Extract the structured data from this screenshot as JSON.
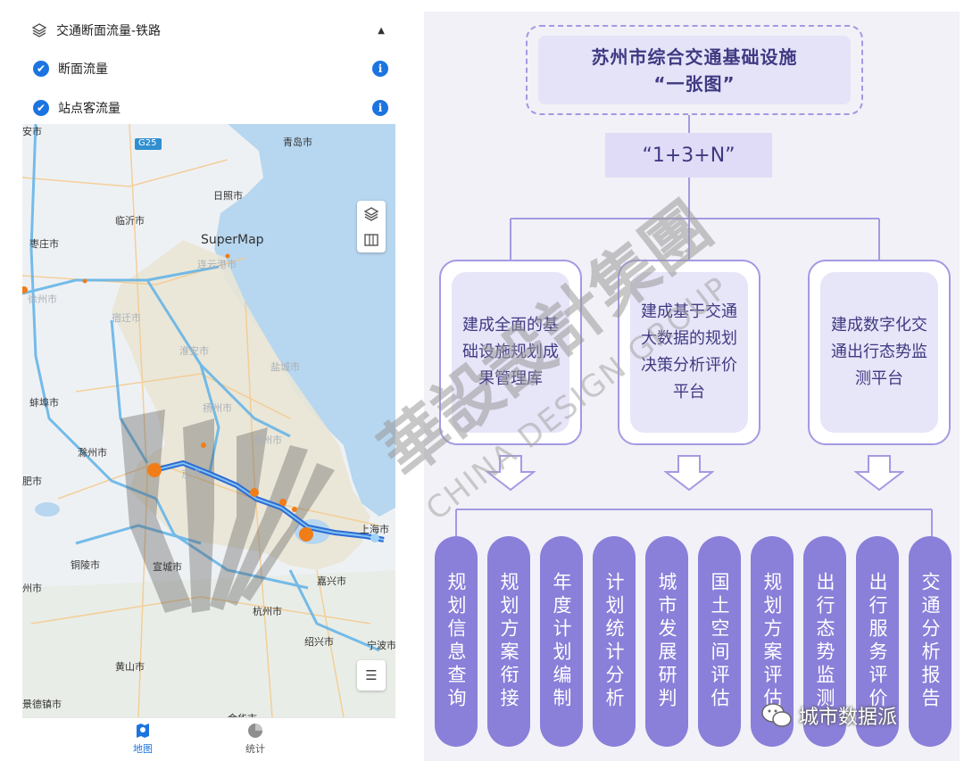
{
  "layer_panel": {
    "title": "交通断面流量-铁路",
    "options": [
      {
        "label": "断面流量",
        "checked": true
      },
      {
        "label": "站点客流量",
        "checked": true
      }
    ],
    "info_glyph": "i",
    "collapse_glyph": "▲"
  },
  "map": {
    "road_shield": "G25",
    "brand": "SuperMap",
    "cities": [
      {
        "name": "安市",
        "faint": false
      },
      {
        "name": "青岛市",
        "faint": false
      },
      {
        "name": "日照市",
        "faint": false
      },
      {
        "name": "临沂市",
        "faint": false
      },
      {
        "name": "枣庄市",
        "faint": false
      },
      {
        "name": "连云港市",
        "faint": true
      },
      {
        "name": "徐州市",
        "faint": true
      },
      {
        "name": "宿迁市",
        "faint": true
      },
      {
        "name": "淮安市",
        "faint": true
      },
      {
        "name": "盐城市",
        "faint": true
      },
      {
        "name": "蚌埠市",
        "faint": false
      },
      {
        "name": "扬州市",
        "faint": true
      },
      {
        "name": "泰州市",
        "faint": true
      },
      {
        "name": "滁州市",
        "faint": false
      },
      {
        "name": "肥市",
        "faint": false
      },
      {
        "name": "上海市",
        "faint": false
      },
      {
        "name": "铜陵市",
        "faint": false
      },
      {
        "name": "宣城市",
        "faint": false
      },
      {
        "name": "嘉兴市",
        "faint": false
      },
      {
        "name": "州市",
        "faint": false
      },
      {
        "name": "杭州市",
        "faint": false
      },
      {
        "name": "绍兴市",
        "faint": false
      },
      {
        "name": "宁波市",
        "faint": false
      },
      {
        "name": "黄山市",
        "faint": false
      },
      {
        "name": "景德镇市",
        "faint": false
      },
      {
        "name": "金华市",
        "faint": false
      },
      {
        "name": "京市",
        "faint": true
      }
    ],
    "icons": {
      "layers": "layers-icon",
      "basemap": "map-icon",
      "legend": "list-icon"
    }
  },
  "bottom_nav": {
    "items": [
      {
        "label": "地图",
        "icon": "map-pin-icon",
        "active": true
      },
      {
        "label": "统计",
        "icon": "pie-chart-icon",
        "active": false
      }
    ]
  },
  "diagram": {
    "title_line1": "苏州市综合交通基础设施",
    "title_line2": "“一张图”",
    "formula": "“1+3+N”",
    "goals": [
      "建成全面的基础设施规划成果管理库",
      "建成基于交通大数据的规划决策分析评价平台",
      "建成数字化交通出行态势监测平台"
    ],
    "functions": [
      "规划信息查询",
      "规划方案衔接",
      "年度计划编制",
      "计划统计分析",
      "城市发展研判",
      "国土空间评估",
      "规划方案评估",
      "出行态势监测",
      "出行服务评价",
      "交通分析报告"
    ],
    "watermark_cn": "華設設計集團",
    "watermark_en": "CHINA DESIGN GROUP",
    "wechat_account": "城市数据派"
  },
  "colors": {
    "accent_blue": "#1c74e0",
    "diagram_purple": "#8a7fd9",
    "diagram_text": "#3f3a82",
    "flow_orange": "#f07d18"
  }
}
